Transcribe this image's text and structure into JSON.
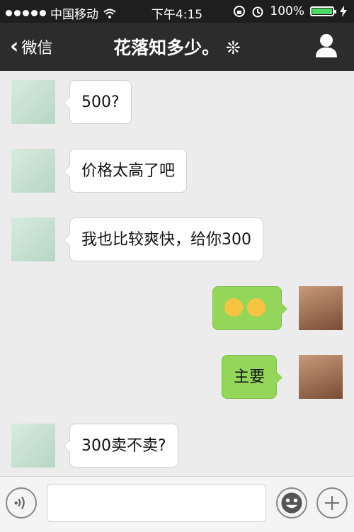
{
  "status_bar": {
    "carrier": "中国移动",
    "time": "下午4:15",
    "battery": "100%",
    "battery_level": 1.0
  },
  "nav": {
    "back_label": "微信",
    "title": "花落知多少。",
    "title_decoration": "❊"
  },
  "messages": [
    {
      "side": "left",
      "text": "500?"
    },
    {
      "side": "left",
      "text": "价格太高了吧"
    },
    {
      "side": "left",
      "text": "我也比较爽快，给你300"
    },
    {
      "side": "right",
      "emoji_count": 2
    },
    {
      "side": "right",
      "text": "主要"
    },
    {
      "side": "left",
      "text": "300卖不卖?"
    }
  ],
  "input": {
    "placeholder": ""
  },
  "colors": {
    "bubble_self": "#94d65a",
    "bubble_other": "#ffffff",
    "nav_bg": "#2c2c2c",
    "status_bg": "#1e1e1e"
  },
  "icons": [
    "wifi-icon",
    "lock-rotation-icon",
    "alarm-icon",
    "battery-icon",
    "charging-icon",
    "back-chevron-icon",
    "profile-icon",
    "voice-icon",
    "emoji-icon",
    "plus-icon"
  ]
}
